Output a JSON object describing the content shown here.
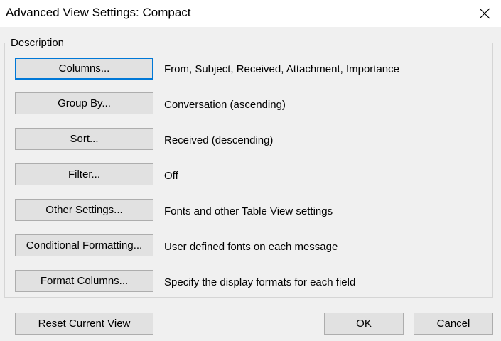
{
  "window": {
    "title": "Advanced View Settings: Compact",
    "close_icon": "close-icon"
  },
  "group": {
    "label": "Description"
  },
  "rows": [
    {
      "button": "Columns...",
      "description": "From, Subject, Received, Attachment, Importance"
    },
    {
      "button": "Group By...",
      "description": "Conversation (ascending)"
    },
    {
      "button": "Sort...",
      "description": "Received (descending)"
    },
    {
      "button": "Filter...",
      "description": "Off"
    },
    {
      "button": "Other Settings...",
      "description": "Fonts and other Table View settings"
    },
    {
      "button": "Conditional Formatting...",
      "description": "User defined fonts on each message"
    },
    {
      "button": "Format Columns...",
      "description": "Specify the display formats for each field"
    }
  ],
  "footer": {
    "reset_label": "Reset Current View",
    "ok_label": "OK",
    "cancel_label": "Cancel"
  },
  "colors": {
    "focus_border": "#0078d7",
    "button_face": "#e1e1e1",
    "dialog_background": "#f0f0f0"
  }
}
